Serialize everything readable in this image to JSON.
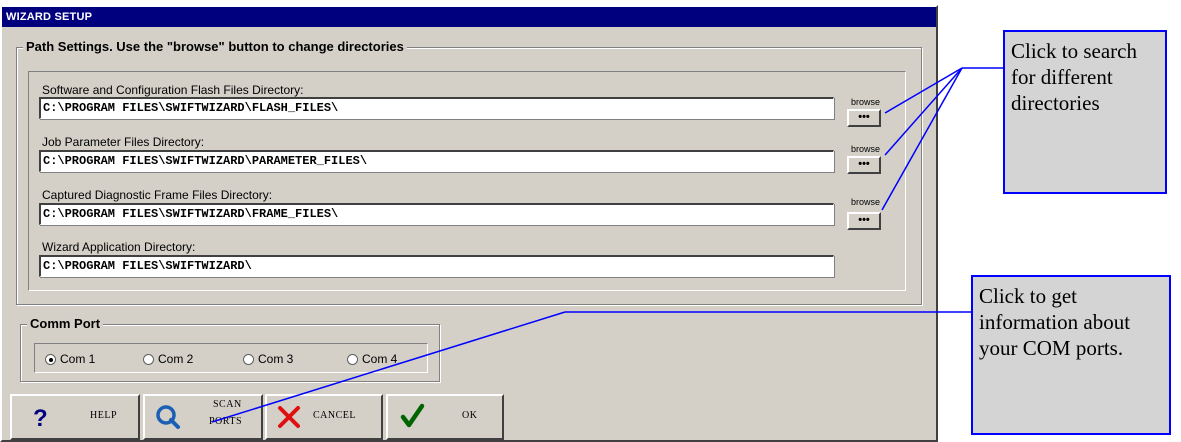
{
  "window": {
    "title": "WIZARD SETUP"
  },
  "path_settings": {
    "legend": "Path Settings. Use the \"browse\" button to change directories",
    "fields": [
      {
        "label": "Software and Configuration Flash Files Directory:",
        "value": "C:\\PROGRAM FILES\\SWIFTWIZARD\\FLASH_FILES\\"
      },
      {
        "label": "Job Parameter Files Directory:",
        "value": "C:\\PROGRAM FILES\\SWIFTWIZARD\\PARAMETER_FILES\\"
      },
      {
        "label": "Captured Diagnostic Frame Files Directory:",
        "value": "C:\\PROGRAM FILES\\SWIFTWIZARD\\FRAME_FILES\\"
      },
      {
        "label": "Wizard Application Directory:",
        "value": "C:\\PROGRAM FILES\\SWIFTWIZARD\\"
      }
    ],
    "browse_label": "browse",
    "browse_button": "•••"
  },
  "comm_port": {
    "legend": "Comm Port",
    "options": [
      "Com 1",
      "Com 2",
      "Com 3",
      "Com 4"
    ],
    "selected": "Com 1"
  },
  "buttons": {
    "help": "HELP",
    "scan_line1": "SCAN",
    "scan_line2": "PORTS",
    "cancel": "CANCEL",
    "ok": "OK"
  },
  "callouts": {
    "browse": "Click to search for different directories",
    "scan": "Click to get information about your COM ports."
  },
  "colors": {
    "title_bar": "#00007f",
    "dialog": "#d4d0c8",
    "callout_border": "#0000ff",
    "callout_fill": "#d4d4d4",
    "help_icon": "#000080",
    "search_icon": "#1a5fb4",
    "cancel_icon": "#e01010",
    "ok_icon": "#006400"
  }
}
